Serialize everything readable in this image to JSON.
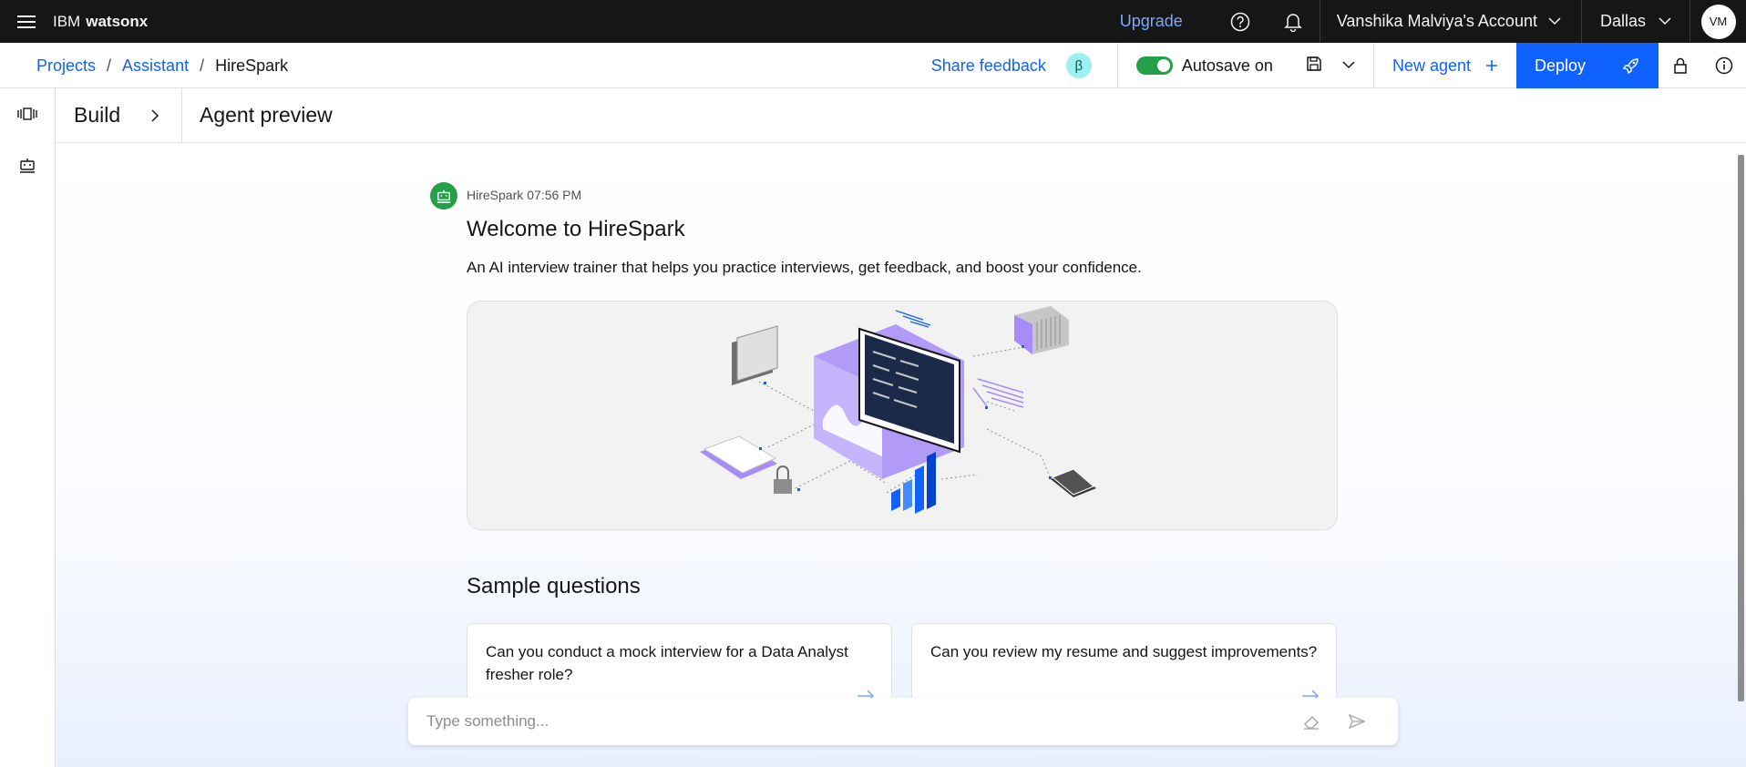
{
  "masthead": {
    "brand_prefix": "IBM",
    "brand_name": "watsonx",
    "upgrade_label": "Upgrade",
    "account_label": "Vanshika Malviya's Account",
    "region_label": "Dallas",
    "avatar_initials": "VM"
  },
  "breadcrumb": {
    "items": [
      "Projects",
      "Assistant",
      "HireSpark"
    ],
    "separator": "/"
  },
  "toolbar": {
    "share_feedback_label": "Share feedback",
    "beta_badge": "β",
    "autosave_label": "Autosave on",
    "autosave_on": true,
    "new_agent_label": "New agent",
    "deploy_label": "Deploy"
  },
  "builder": {
    "build_label": "Build",
    "preview_title": "Agent preview"
  },
  "chat": {
    "bot_name": "HireSpark",
    "timestamp": "07:56 PM",
    "welcome_title": "Welcome to HireSpark",
    "description": "An AI interview trainer that helps you practice interviews, get feedback, and boost your confidence.",
    "sample_questions_title": "Sample questions",
    "sample_questions": [
      "Can you conduct a mock interview for a Data Analyst fresher role?",
      "Can you review my resume and suggest improvements?"
    ],
    "input_placeholder": "Type something..."
  },
  "colors": {
    "masthead_bg": "#161616",
    "link_blue": "#0f62fe",
    "upgrade_blue": "#78a9ff",
    "toggle_green": "#24a148",
    "illustration_purple": "#a78bfa"
  }
}
